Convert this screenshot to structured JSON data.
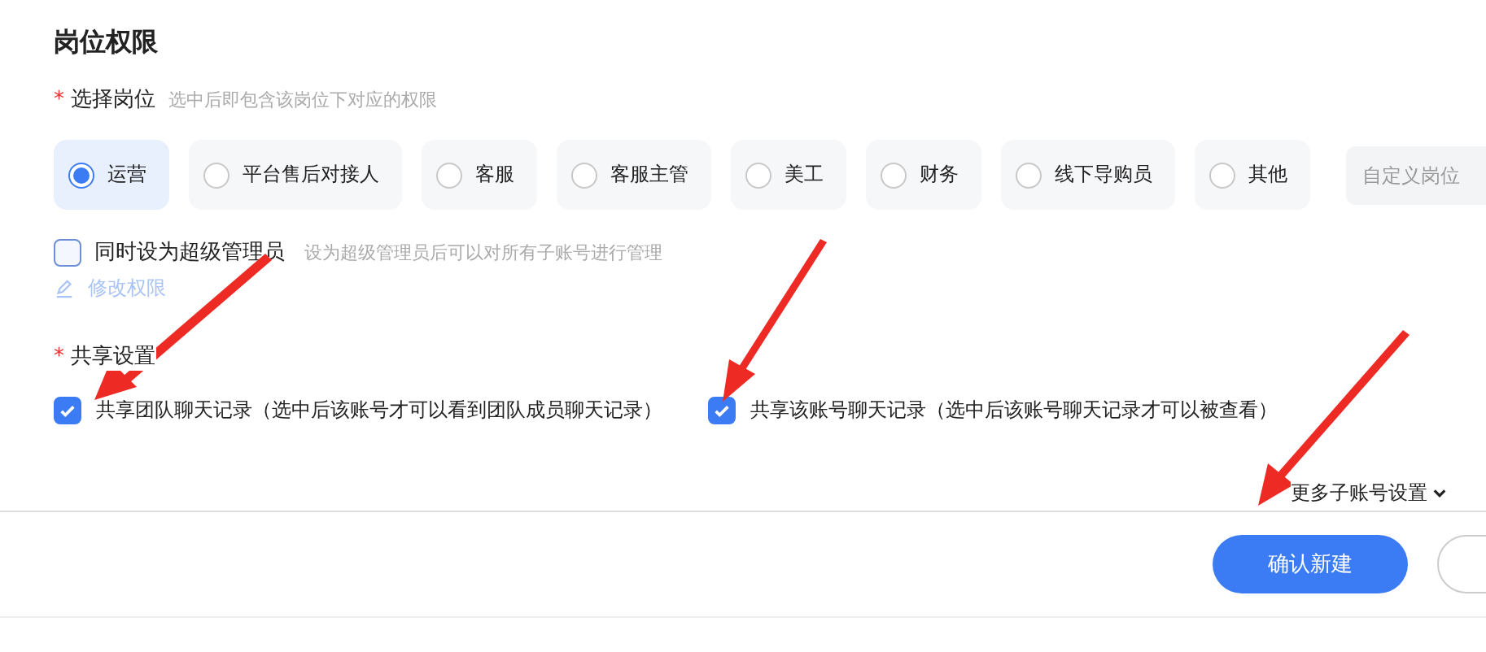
{
  "section_title": "岗位权限",
  "position": {
    "label": "选择岗位",
    "required_mark": "*",
    "hint": "选中后即包含该岗位下对应的权限",
    "options": [
      {
        "label": "运营",
        "selected": true
      },
      {
        "label": "平台售后对接人",
        "selected": false
      },
      {
        "label": "客服",
        "selected": false
      },
      {
        "label": "客服主管",
        "selected": false
      },
      {
        "label": "美工",
        "selected": false
      },
      {
        "label": "财务",
        "selected": false
      },
      {
        "label": "线下导购员",
        "selected": false
      },
      {
        "label": "其他",
        "selected": false
      }
    ],
    "custom": {
      "placeholder": "自定义岗位"
    }
  },
  "super_admin": {
    "label": "同时设为超级管理员",
    "hint": "设为超级管理员后可以对所有子账号进行管理",
    "checked": false
  },
  "edit_link": "修改权限",
  "sharing": {
    "label": "共享设置",
    "required_mark": "*",
    "options": [
      {
        "label": "共享团队聊天记录（选中后该账号才可以看到团队成员聊天记录）",
        "checked": true
      },
      {
        "label": "共享该账号聊天记录（选中后该账号聊天记录才可以被查看）",
        "checked": true
      }
    ]
  },
  "more_settings": "更多子账号设置",
  "confirm_button": "确认新建"
}
